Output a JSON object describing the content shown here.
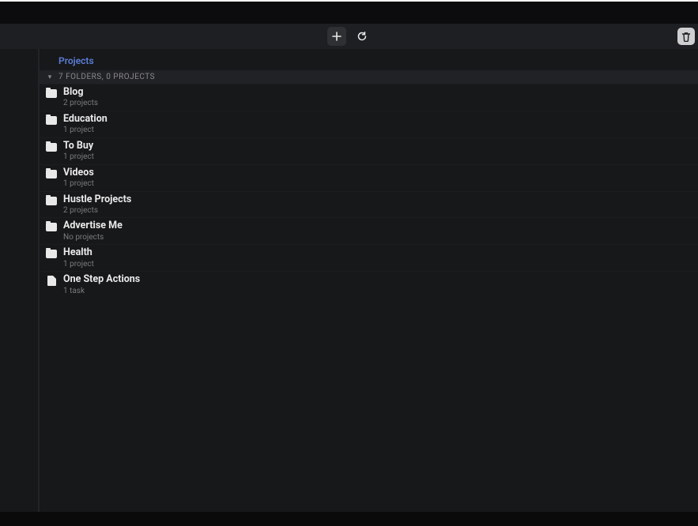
{
  "breadcrumb": {
    "label": "Projects"
  },
  "summary": {
    "text": "7 FOLDERS, 0 PROJECTS"
  },
  "items": [
    {
      "kind": "folder",
      "title": "Blog",
      "sub": "2 projects"
    },
    {
      "kind": "folder",
      "title": "Education",
      "sub": "1 project"
    },
    {
      "kind": "folder",
      "title": "To Buy",
      "sub": "1 project"
    },
    {
      "kind": "folder",
      "title": "Videos",
      "sub": "1 project"
    },
    {
      "kind": "folder",
      "title": "Hustle Projects",
      "sub": "2 projects"
    },
    {
      "kind": "folder",
      "title": "Advertise Me",
      "sub": "No projects"
    },
    {
      "kind": "folder",
      "title": "Health",
      "sub": "1 project"
    },
    {
      "kind": "doc",
      "title": "One Step Actions",
      "sub": "1 task"
    }
  ]
}
